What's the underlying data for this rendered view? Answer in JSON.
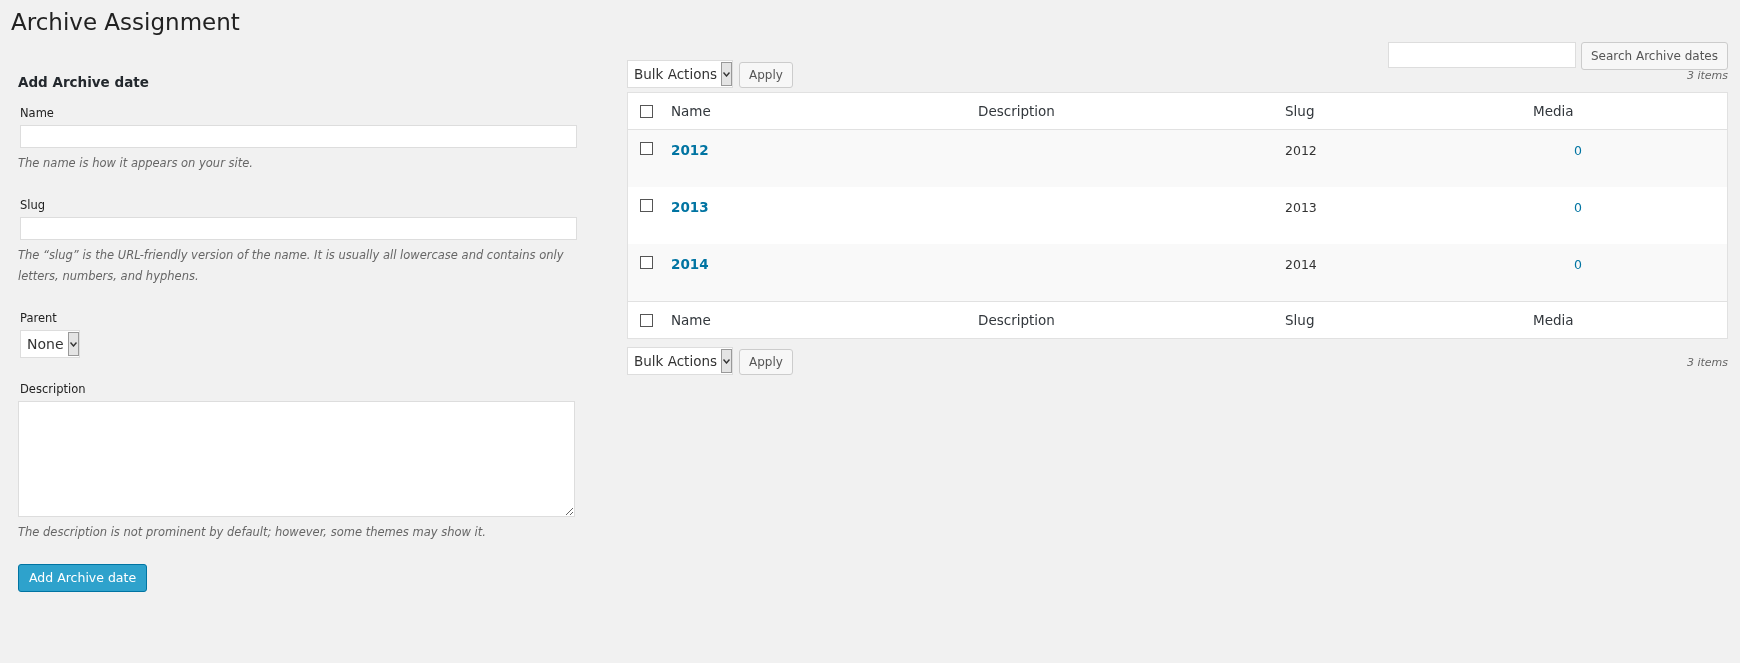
{
  "page_title": "Archive Assignment",
  "search": {
    "button": "Search Archive dates"
  },
  "form": {
    "heading": "Add Archive date",
    "fields": [
      {
        "kind": "input",
        "label": "Name",
        "hint": "The name is how it appears on your site."
      },
      {
        "kind": "input",
        "label": "Slug",
        "hint": "The “slug” is the URL-friendly version of the name. It is usually all lowercase and contains only letters, numbers, and hyphens."
      },
      {
        "kind": "select",
        "label": "Parent",
        "value": "None"
      },
      {
        "kind": "textarea",
        "label": "Description",
        "hint": "The description is not prominent by default; however, some themes may show it."
      }
    ],
    "submit": "Add Archive date"
  },
  "top_nav": {
    "bulk_action": "Bulk Actions",
    "apply": "Apply",
    "count": "3 items"
  },
  "table": {
    "header_checked": false,
    "footer_checked": false,
    "columns": [
      "Name",
      "Description",
      "Slug",
      "Media"
    ],
    "footer_columns": [
      "Name",
      "Description",
      "Slug",
      "Media"
    ],
    "rows": [
      {
        "checked": false,
        "name": "2012",
        "slug": "2012",
        "media": "0"
      },
      {
        "checked": false,
        "name": "2013",
        "slug": "2013",
        "media": "0"
      },
      {
        "checked": false,
        "name": "2014",
        "slug": "2014",
        "media": "0"
      }
    ]
  },
  "bottom_nav": {
    "bulk_action": "Bulk Actions",
    "apply": "Apply",
    "count": "3 items"
  }
}
